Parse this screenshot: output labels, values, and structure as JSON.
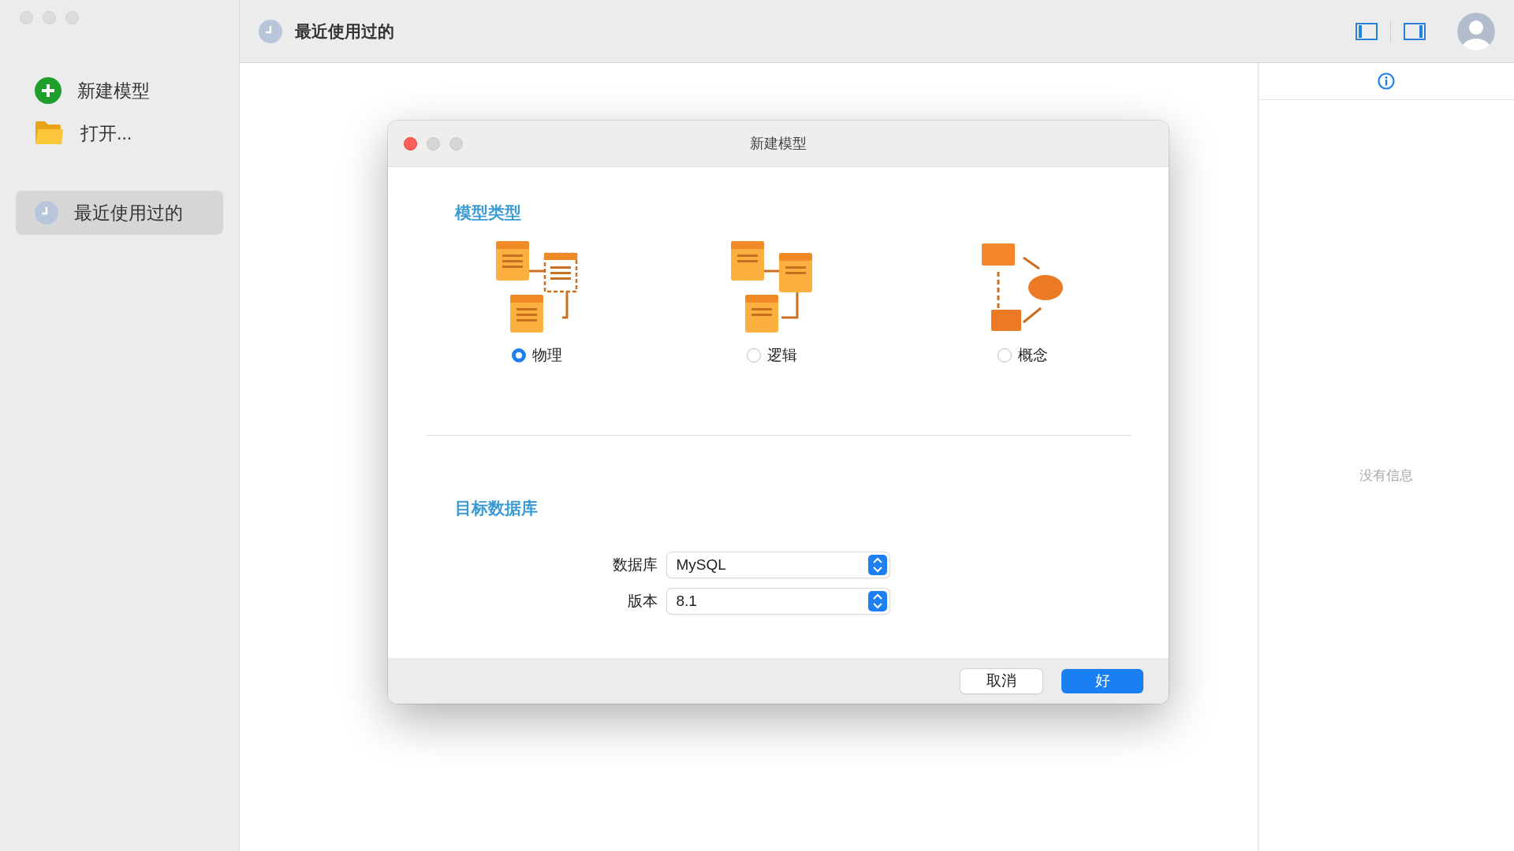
{
  "sidebar": {
    "items": [
      {
        "label": "新建模型",
        "kind": "new",
        "selected": false
      },
      {
        "label": "打开...",
        "kind": "open",
        "selected": false
      },
      {
        "label": "最近使用过的",
        "kind": "recent",
        "selected": true
      }
    ]
  },
  "header": {
    "title": "最近使用过的"
  },
  "info_panel": {
    "empty_text": "没有信息"
  },
  "dialog": {
    "title": "新建模型",
    "model_type": {
      "heading": "模型类型",
      "options": [
        {
          "label": "物理",
          "kind": "physical",
          "selected": true
        },
        {
          "label": "逻辑",
          "kind": "logical",
          "selected": false
        },
        {
          "label": "概念",
          "kind": "conceptual",
          "selected": false
        }
      ]
    },
    "target_database": {
      "heading": "目标数据库",
      "fields": [
        {
          "label": "数据库",
          "value": "MySQL"
        },
        {
          "label": "版本",
          "value": "8.1"
        }
      ]
    },
    "buttons": [
      {
        "label": "取消",
        "kind": "secondary"
      },
      {
        "label": "好",
        "kind": "primary"
      }
    ]
  }
}
